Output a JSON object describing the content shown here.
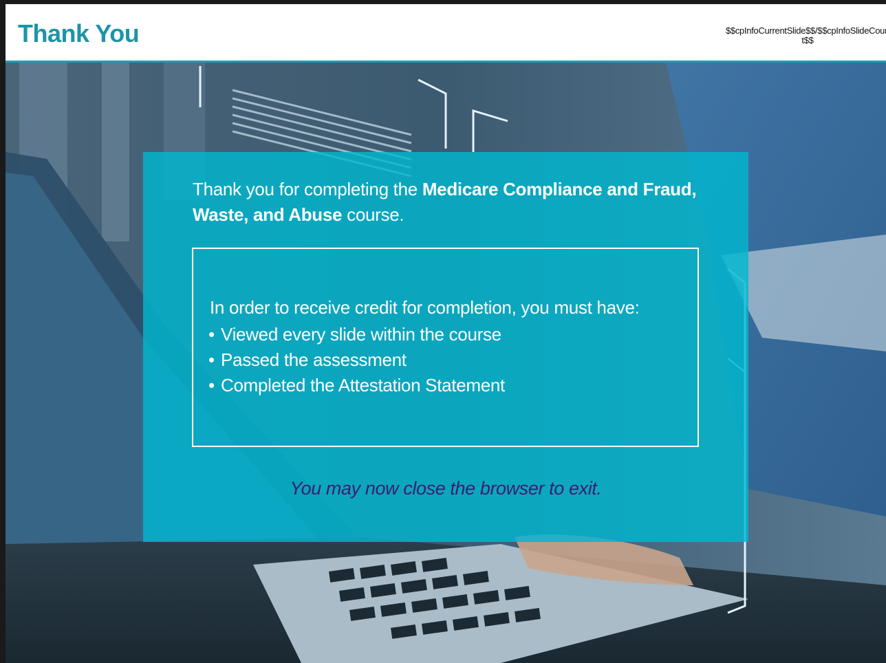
{
  "header": {
    "title": "Thank You",
    "slide_counter": "$$cpInfoCurrentSlide$$/$$cpInfoSlideCount$$"
  },
  "card": {
    "intro_prefix": "Thank you for completing the ",
    "course_name": "Medicare Compliance and Fraud, Waste, and Abuse",
    "intro_suffix": " course.",
    "requirements_heading": "In order to receive credit for completion, you must have:",
    "requirements": [
      "Viewed every slide within the course",
      "Passed the assessment",
      "Completed the Attestation Statement"
    ],
    "exit_message": "You may now close the browser to exit."
  },
  "colors": {
    "accent": "#1b95a6",
    "card_bg": "#00b7d0",
    "exit_text": "#3a1f6e"
  },
  "icons": {
    "bullet": "•",
    "background_lock": "padlock-icon"
  }
}
